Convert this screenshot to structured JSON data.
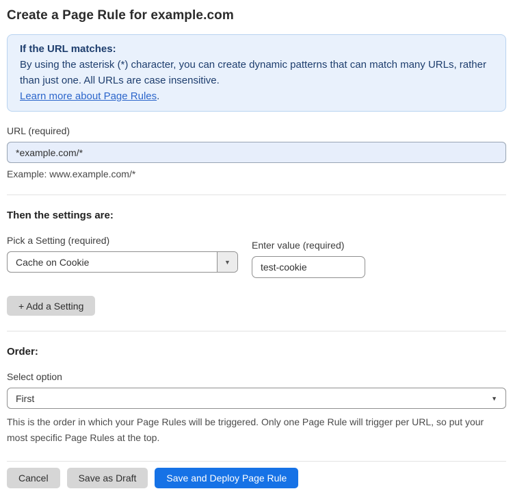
{
  "page": {
    "title": "Create a Page Rule for example.com"
  },
  "info_box": {
    "heading": "If the URL matches:",
    "body": "By using the asterisk (*) character, you can create dynamic patterns that can match many URLs, rather than just one. All URLs are case insensitive.",
    "link": "Learn more about Page Rules",
    "link_suffix": "."
  },
  "url_field": {
    "label": "URL (required)",
    "value": "*example.com/*",
    "helper": "Example: www.example.com/*"
  },
  "settings_section": {
    "heading": "Then the settings are:",
    "setting_label": "Pick a Setting (required)",
    "setting_value": "Cache on Cookie",
    "value_label": "Enter value (required)",
    "value_text": "test-cookie",
    "add_button_label": "+ Add a Setting"
  },
  "order_section": {
    "heading": "Order:",
    "select_label": "Select option",
    "select_value": "First",
    "helper": "This is the order in which your Page Rules will be triggered. Only one Page Rule will trigger per URL, so put your most specific Page Rules at the top."
  },
  "footer": {
    "cancel_label": "Cancel",
    "save_draft_label": "Save as Draft",
    "save_deploy_label": "Save and Deploy Page Rule"
  },
  "icons": {
    "dropdown_arrow": "▼"
  },
  "colors": {
    "primary_blue": "#1672e6",
    "info_bg": "#e9f1fc",
    "info_border": "#b9d3f0",
    "info_text": "#1d3d6d",
    "link_blue": "#2c66cb",
    "autofill_input_bg": "#e7eefb",
    "gray_button_bg": "#d6d6d6"
  }
}
